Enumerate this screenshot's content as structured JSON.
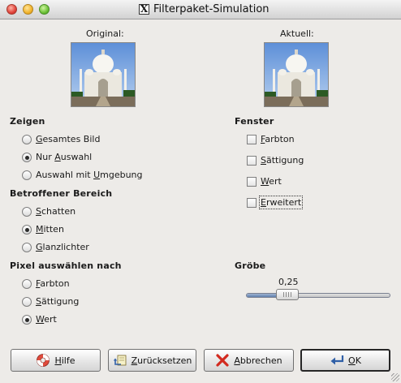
{
  "window": {
    "title": "Filterpaket-Simulation",
    "app_icon": "X"
  },
  "preview": {
    "original_label": "Original:",
    "current_label": "Aktuell:"
  },
  "show_section": {
    "heading": "Zeigen",
    "options": [
      {
        "pre": "",
        "mnem": "G",
        "post": "esamtes Bild",
        "selected": false
      },
      {
        "pre": "Nur ",
        "mnem": "A",
        "post": "uswahl",
        "selected": true
      },
      {
        "pre": "Auswahl mit ",
        "mnem": "U",
        "post": "mgebung",
        "selected": false
      }
    ]
  },
  "affected_section": {
    "heading": "Betroffener Bereich",
    "options": [
      {
        "pre": "",
        "mnem": "S",
        "post": "chatten",
        "selected": false
      },
      {
        "pre": "",
        "mnem": "M",
        "post": "itten",
        "selected": true
      },
      {
        "pre": "",
        "mnem": "G",
        "post": "lanzlichter",
        "selected": false
      }
    ]
  },
  "select_section": {
    "heading": "Pixel auswählen nach",
    "options": [
      {
        "pre": "",
        "mnem": "F",
        "post": "arbton",
        "selected": false
      },
      {
        "pre": "",
        "mnem": "S",
        "post": "ättigung",
        "selected": false
      },
      {
        "pre": "",
        "mnem": "W",
        "post": "ert",
        "selected": true
      }
    ]
  },
  "window_section": {
    "heading": "Fenster",
    "options": [
      {
        "pre": "",
        "mnem": "F",
        "post": "arbton",
        "checked": false
      },
      {
        "pre": "",
        "mnem": "S",
        "post": "ättigung",
        "checked": false
      },
      {
        "pre": "",
        "mnem": "W",
        "post": "ert",
        "checked": false
      },
      {
        "pre": "",
        "mnem": "E",
        "post": "rweitert",
        "checked": false
      }
    ]
  },
  "roughness": {
    "heading": "Gröbe",
    "value_label": "0,25",
    "value": 0.25
  },
  "buttons": {
    "help": {
      "mnem": "H",
      "post": "ilfe",
      "icon": "lifebuoy-icon"
    },
    "reset": {
      "mnem": "Z",
      "post": "urücksetzen",
      "icon": "reset-icon"
    },
    "cancel": {
      "mnem": "A",
      "post": "bbrechen",
      "icon": "cancel-x-icon"
    },
    "ok": {
      "mnem": "O",
      "post": "K",
      "icon": "ok-arrow-icon"
    }
  },
  "colors": {
    "background": "#edebe8",
    "slider_fill": "#7591bd"
  }
}
